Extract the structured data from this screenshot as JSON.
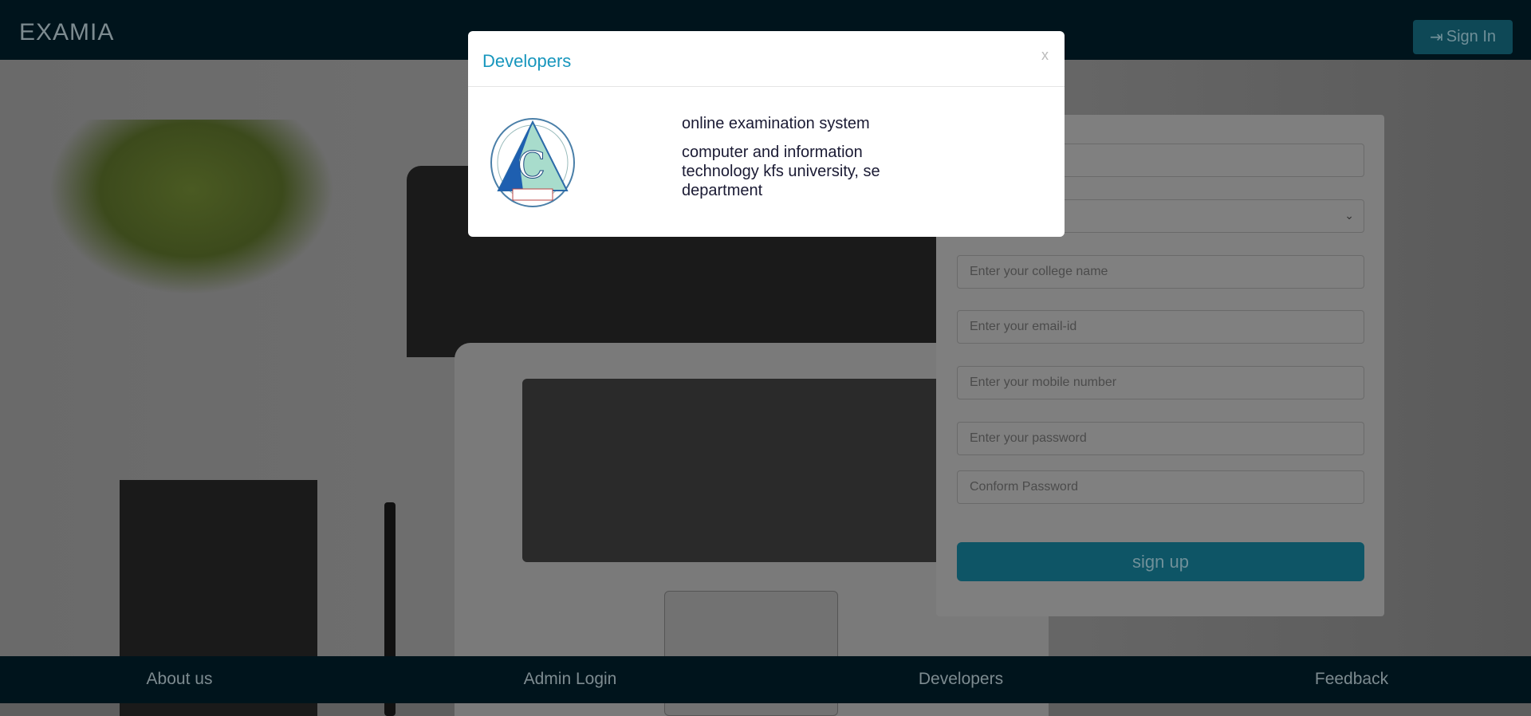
{
  "header": {
    "brand": "EXAMIA",
    "signin_label": "Sign In"
  },
  "form": {
    "fields": [
      {
        "placeholder": ""
      },
      {
        "placeholder": ""
      },
      {
        "placeholder": "Enter your college name"
      },
      {
        "placeholder": "Enter your email-id"
      },
      {
        "placeholder": "Enter your mobile number"
      },
      {
        "placeholder": "Enter your password"
      },
      {
        "placeholder": "Conform Password"
      }
    ],
    "submit_label": "sign up"
  },
  "footer": {
    "items": [
      "About us",
      "Admin Login",
      "Developers",
      "Feedback"
    ]
  },
  "modal": {
    "title": "Developers",
    "close": "x",
    "line1": "online examination system",
    "line2": "computer and information technology kfs university, se department"
  },
  "colors": {
    "accent": "#1796bd",
    "header_bg": "#00141c"
  }
}
